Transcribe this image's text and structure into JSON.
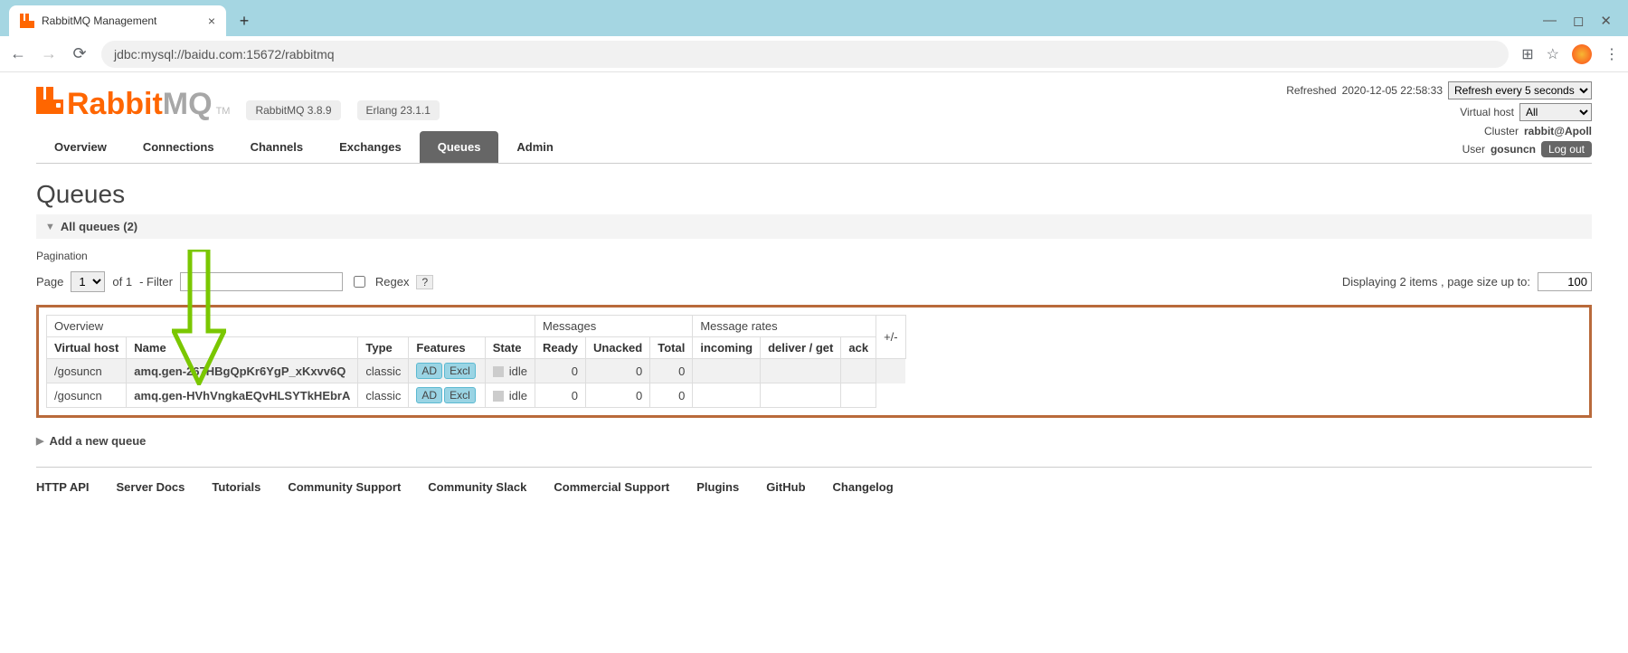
{
  "browser": {
    "tab_title": "RabbitMQ Management",
    "url": "jdbc:mysql://baidu.com:15672/rabbitmq"
  },
  "status": {
    "refreshed_label": "Refreshed",
    "refreshed_time": "2020-12-05 22:58:33",
    "refresh_select": "Refresh every 5 seconds",
    "vhost_label": "Virtual host",
    "vhost_select": "All",
    "cluster_label": "Cluster",
    "cluster_name": "rabbit@Apoll",
    "user_label": "User",
    "user_name": "gosuncn",
    "logout": "Log out"
  },
  "logo": {
    "rabbit": "Rabbit",
    "mq": "MQ",
    "tm": "TM",
    "version": "RabbitMQ 3.8.9",
    "erlang": "Erlang 23.1.1"
  },
  "nav": {
    "overview": "Overview",
    "connections": "Connections",
    "channels": "Channels",
    "exchanges": "Exchanges",
    "queues": "Queues",
    "admin": "Admin"
  },
  "page_title": "Queues",
  "all_queues": "All queues (2)",
  "pagination_label": "Pagination",
  "pager": {
    "page_label": "Page",
    "page_value": "1",
    "of_label": "of 1",
    "filter_label": "- Filter",
    "regex_label": "Regex",
    "help": "?",
    "displaying": "Displaying 2 items , page size up to:",
    "page_size": "100"
  },
  "table": {
    "group_overview": "Overview",
    "group_messages": "Messages",
    "group_rates": "Message rates",
    "plusminus": "+/-",
    "cols": {
      "vhost": "Virtual host",
      "name": "Name",
      "type": "Type",
      "features": "Features",
      "state": "State",
      "ready": "Ready",
      "unacked": "Unacked",
      "total": "Total",
      "incoming": "incoming",
      "deliver": "deliver / get",
      "ack": "ack"
    },
    "rows": [
      {
        "vhost": "/gosuncn",
        "name": "amq.gen-267HBgQpKr6YgP_xKxvv6Q",
        "type": "classic",
        "feat_ad": "AD",
        "feat_excl": "Excl",
        "state": "idle",
        "ready": "0",
        "unacked": "0",
        "total": "0"
      },
      {
        "vhost": "/gosuncn",
        "name": "amq.gen-HVhVngkaEQvHLSYTkHEbrA",
        "type": "classic",
        "feat_ad": "AD",
        "feat_excl": "Excl",
        "state": "idle",
        "ready": "0",
        "unacked": "0",
        "total": "0"
      }
    ]
  },
  "add_queue": "Add a new queue",
  "footer": {
    "http_api": "HTTP API",
    "server_docs": "Server Docs",
    "tutorials": "Tutorials",
    "community_support": "Community Support",
    "community_slack": "Community Slack",
    "commercial_support": "Commercial Support",
    "plugins": "Plugins",
    "github": "GitHub",
    "changelog": "Changelog"
  }
}
